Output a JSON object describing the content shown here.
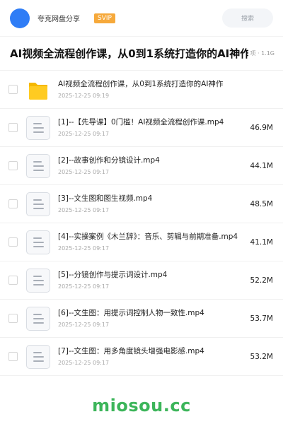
{
  "header": {
    "user_name": "夸克网盘分享",
    "badge": "SVIP",
    "search_placeholder": "搜索",
    "colors": {
      "avatar": "#2f7df6",
      "badge": "#f6a93b"
    }
  },
  "title": {
    "text": "AI视频全流程创作课，从0到1系统打造你的AI神作",
    "meta": "项 · 1.1G"
  },
  "files": [
    {
      "icon": "folder-icon",
      "name": "AI视频全流程创作课，从0到1系统打造你的AI神作",
      "date": "2025-12-25 09:19",
      "size": ""
    },
    {
      "icon": "document-icon",
      "name": "[1]--【先导课】0门槛！AI视频全流程创作课.mp4",
      "date": "2025-12-25 09:17",
      "size": "46.9M"
    },
    {
      "icon": "document-icon",
      "name": "[2]--故事创作和分镜设计.mp4",
      "date": "2025-12-25 09:17",
      "size": "44.1M"
    },
    {
      "icon": "document-icon",
      "name": "[3]--文生图和图生视频.mp4",
      "date": "2025-12-25 09:17",
      "size": "48.5M"
    },
    {
      "icon": "document-icon",
      "name": "[4]--实操案例《木兰辞》：音乐、剪辑与前期准备.mp4",
      "date": "2025-12-25 09:17",
      "size": "41.1M"
    },
    {
      "icon": "document-icon",
      "name": "[5]--分镜创作与提示词设计.mp4",
      "date": "2025-12-25 09:17",
      "size": "52.2M"
    },
    {
      "icon": "document-icon",
      "name": "[6]--文生图：用提示词控制人物一致性.mp4",
      "date": "2025-12-25 09:17",
      "size": "53.7M"
    },
    {
      "icon": "document-icon",
      "name": "[7]--文生图：用多角度镜头增强电影感.mp4",
      "date": "2025-12-25 09:17",
      "size": "53.2M"
    }
  ],
  "watermark": "miosou.cc"
}
